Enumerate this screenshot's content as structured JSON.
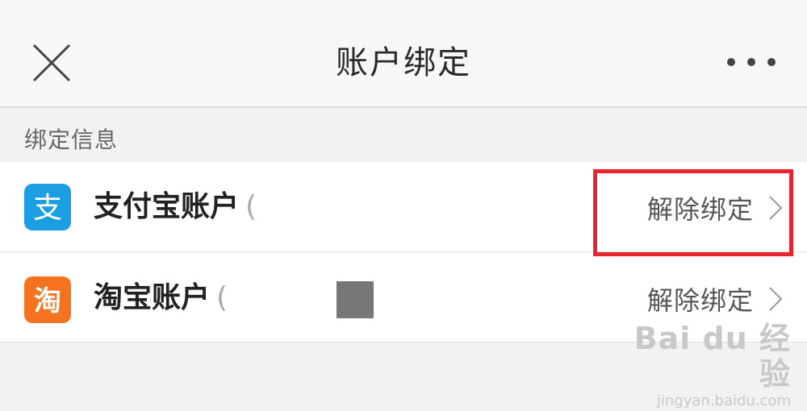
{
  "header": {
    "title": "账户绑定",
    "close_icon": "close-icon",
    "more_icon": "more-horizontal-icon"
  },
  "section": {
    "label": "绑定信息"
  },
  "accounts": [
    {
      "name": "支付宝账户",
      "paren": "(",
      "icon": "alipay-icon",
      "icon_glyph": "支",
      "icon_color": "#1c9ee3",
      "action_label": "解除绑定",
      "highlighted": true
    },
    {
      "name": "淘宝账户",
      "paren": "(",
      "icon": "taobao-icon",
      "icon_glyph": "淘",
      "icon_color": "#f5731f",
      "action_label": "解除绑定",
      "highlighted": false
    }
  ],
  "colors": {
    "highlight": "#e8232c",
    "background": "#f2f2f2"
  },
  "watermark": {
    "brand": "Bai du 经验",
    "url": "jingyan.baidu.com"
  }
}
